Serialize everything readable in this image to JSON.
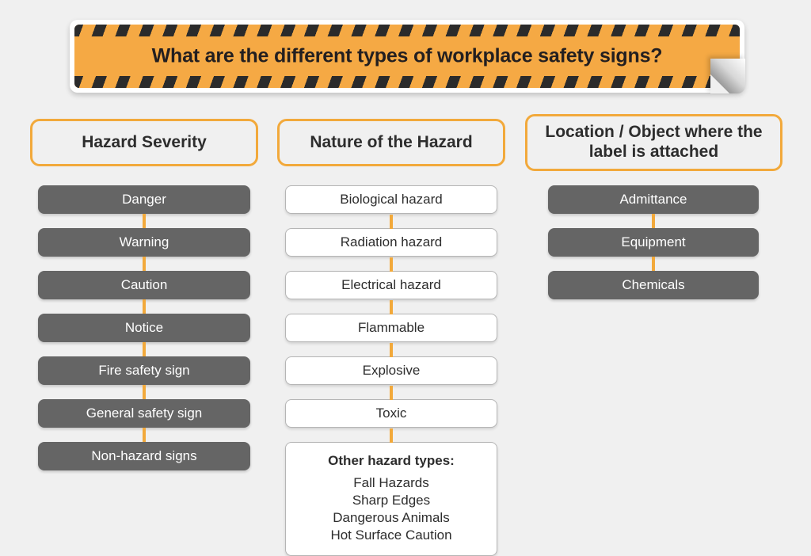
{
  "banner": {
    "title": "What are the different types of workplace safety signs?",
    "accent_color": "#F5A944",
    "stripe_color": "#2b2b2b"
  },
  "theme": {
    "page_background": "#f0f0f0",
    "orange": "#F2A93B",
    "gray_pill": "#656565",
    "white_box": "#ffffff",
    "text_dark": "#2d2d2d"
  },
  "columns": [
    {
      "header": "Hazard Severity",
      "style": "gray",
      "items": [
        {
          "label": "Danger"
        },
        {
          "label": "Warning"
        },
        {
          "label": "Caution"
        },
        {
          "label": "Notice"
        },
        {
          "label": "Fire safety sign"
        },
        {
          "label": "General safety sign"
        },
        {
          "label": "Non-hazard signs"
        }
      ]
    },
    {
      "header": "Nature of the Hazard",
      "style": "white",
      "items": [
        {
          "label": "Biological hazard"
        },
        {
          "label": "Radiation hazard"
        },
        {
          "label": "Electrical hazard"
        },
        {
          "label": "Flammable"
        },
        {
          "label": "Explosive"
        },
        {
          "label": "Toxic"
        }
      ],
      "other_box": {
        "title": "Other hazard types:",
        "items": [
          "Fall Hazards",
          "Sharp Edges",
          "Dangerous Animals",
          "Hot Surface Caution"
        ]
      }
    },
    {
      "header": "Location / Object where the label is attached",
      "style": "gray",
      "items": [
        {
          "label": "Admittance"
        },
        {
          "label": "Equipment"
        },
        {
          "label": "Chemicals"
        }
      ]
    }
  ]
}
